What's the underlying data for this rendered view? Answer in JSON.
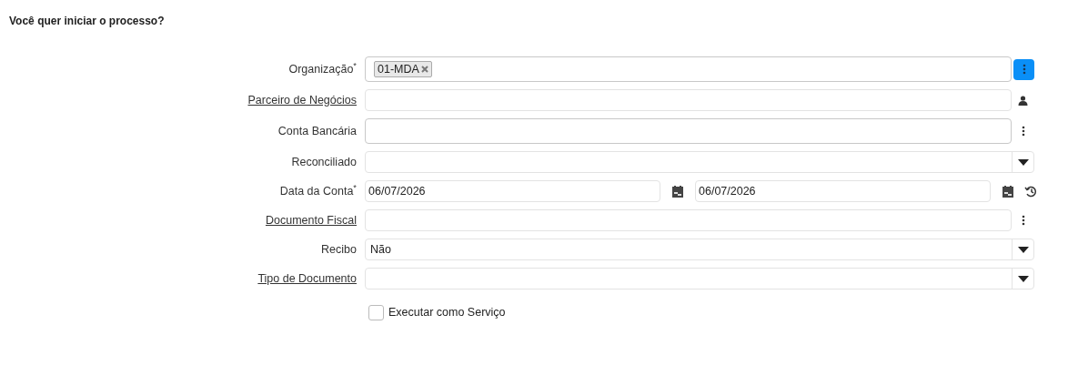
{
  "title": "Você quer iniciar o processo?",
  "fields": [
    {
      "kind": "tags",
      "label": "Organização$^{*}$",
      "link": false,
      "tags": [
        "01-MDA"
      ]
    },
    {
      "kind": "person_lookup",
      "label": "Parceiro de Negócios",
      "link": true
    },
    {
      "kind": "lookup",
      "label": "Conta Bancária",
      "link": false
    },
    {
      "kind": "select",
      "label": "Reconciliado",
      "link": false
    },
    {
      "kind": "dates",
      "label": "Data da Conta$^{*}$",
      "link": false,
      "values": [
        "06/07/2026",
        "06/07/2026"
      ]
    },
    {
      "kind": "search",
      "label": "Documento Fiscal",
      "link": true
    },
    {
      "kind": "select",
      "label": "Recibo",
      "link": false,
      "value": "Não"
    },
    {
      "kind": "select",
      "label": "Tipo de Documento",
      "link": true
    }
  ],
  "checkbox": {
    "label": "Executar como Serviço",
    "checked": false
  }
}
